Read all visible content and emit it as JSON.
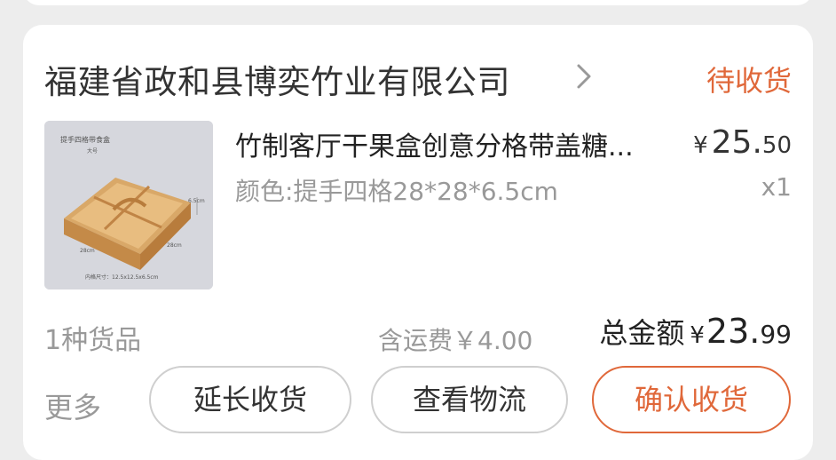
{
  "order": {
    "shop_name": "福建省政和县博奕竹业有限公司",
    "status": "待收货",
    "product": {
      "title": "竹制客厅干果盒创意分格带盖糖...",
      "spec": "颜色:提手四格28*28*6.5cm",
      "price_symbol": "¥",
      "price_int": "25.",
      "price_dec": "50",
      "quantity": "x1",
      "image": {
        "top_label": "提手四格带食盒",
        "size_label": "大号",
        "dim_height": "6.5cm",
        "dim_width": "28cm",
        "dim_depth": "28cm",
        "inner_label": "内格尺寸：12.5x12.5x6.5cm"
      }
    },
    "item_count": "1种货品",
    "freight": "含运费￥4.00",
    "total_label": "总金额",
    "total_symbol": "¥",
    "total_int": "23.",
    "total_dec": "99"
  },
  "actions": {
    "more": "更多",
    "extend": "延长收货",
    "logistics": "查看物流",
    "confirm": "确认收货"
  },
  "colors": {
    "accent": "#e0683a",
    "background": "#ededed",
    "card": "#ffffff",
    "muted_text": "#999999"
  },
  "icons": {
    "shop_chevron": "chevron-right-icon"
  }
}
